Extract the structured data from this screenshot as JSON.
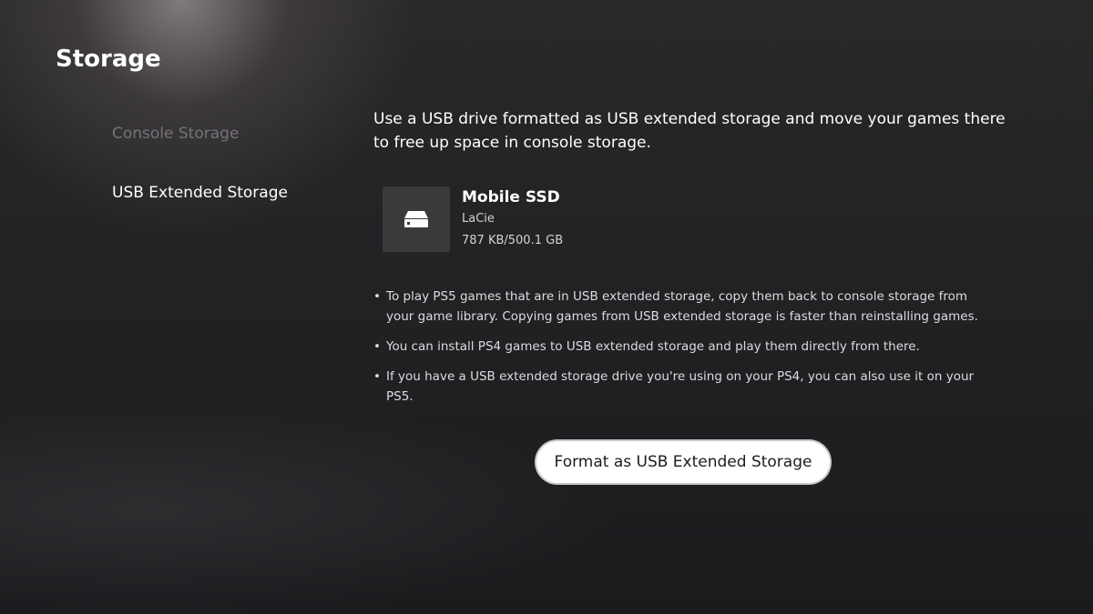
{
  "header": {
    "title": "Storage"
  },
  "sidebar": {
    "items": [
      {
        "label": "Console Storage"
      },
      {
        "label": "USB Extended Storage"
      }
    ]
  },
  "main": {
    "intro": "Use a USB drive formatted as USB extended storage and move your games there to free up space in console storage.",
    "drive": {
      "icon": "external-drive-icon",
      "name": "Mobile SSD",
      "brand": "LaCie",
      "capacity": "787 KB/500.1 GB"
    },
    "notes": [
      "To play PS5 games that are in USB extended storage, copy them back to console storage from your game library. Copying games from USB extended storage is faster than reinstalling games.",
      "You can install PS4 games to USB extended storage and play them directly from there.",
      "If you have a USB extended storage drive you're using on your PS4, you can also use it on your PS5."
    ],
    "format_button_label": "Format as USB Extended Storage"
  },
  "colors": {
    "background": "#232224",
    "nav_dim": "#76727a",
    "tile": "#3a393c",
    "button_bg": "#ffffff",
    "button_text": "#1d1c1f"
  }
}
